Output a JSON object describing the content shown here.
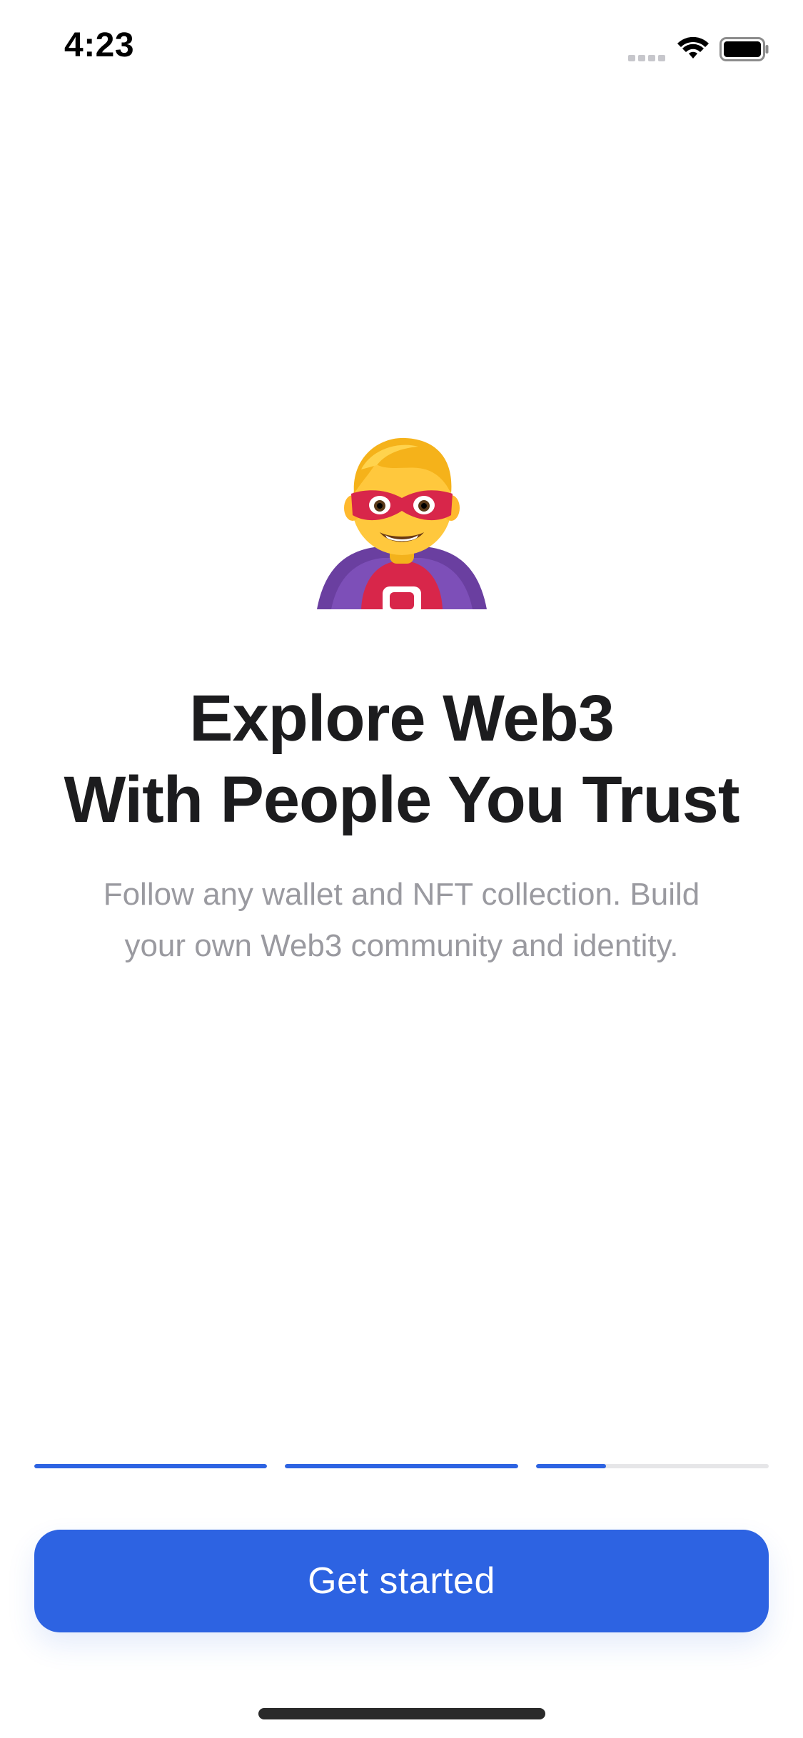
{
  "status_bar": {
    "time": "4:23",
    "signal_icon": "cellular-signal-icon",
    "wifi_icon": "wifi-icon",
    "battery_icon": "battery-icon"
  },
  "hero": {
    "icon": "superhero-emoji-icon"
  },
  "title": {
    "line1": "Explore Web3",
    "line2": "With People You Trust"
  },
  "subtitle": {
    "line1": "Follow any wallet and NFT collection. Build",
    "line2": "your own Web3 community and identity."
  },
  "progress": {
    "segments": [
      1,
      1,
      0.3
    ],
    "active_color": "#2d63e2",
    "inactive_color": "#e6e6e8"
  },
  "cta": {
    "label": "Get started",
    "color": "#2d63e2"
  }
}
